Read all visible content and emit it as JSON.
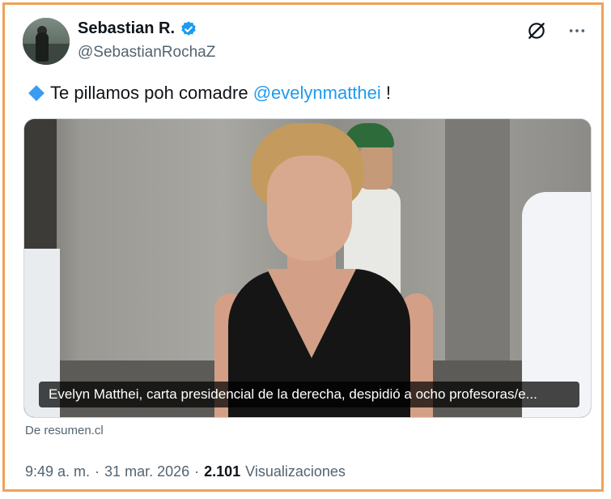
{
  "author": {
    "name": "Sebastian R.",
    "handle": "@SebastianRochaZ",
    "verified_color": "#1d9bf0"
  },
  "tweet": {
    "text": "Te pillamos poh comadre",
    "mention": "@evelynmatthei",
    "suffix": "!"
  },
  "media": {
    "caption": "Evelyn Matthei, carta presidencial de la derecha, despidió a ocho profesoras/e...",
    "source": "De resumen.cl"
  },
  "meta": {
    "time": "9:49 a. m.",
    "sep1": "·",
    "date": "31 mar. 2026",
    "sep2": "·",
    "views_count": "2.101",
    "views_label": "Visualizaciones"
  },
  "icons": {
    "grok": "grok-icon",
    "more": "more-icon",
    "verified": "verified-badge-icon"
  },
  "colors": {
    "border": "#f0a258",
    "accent": "#1d9bf0",
    "muted": "#536471"
  }
}
